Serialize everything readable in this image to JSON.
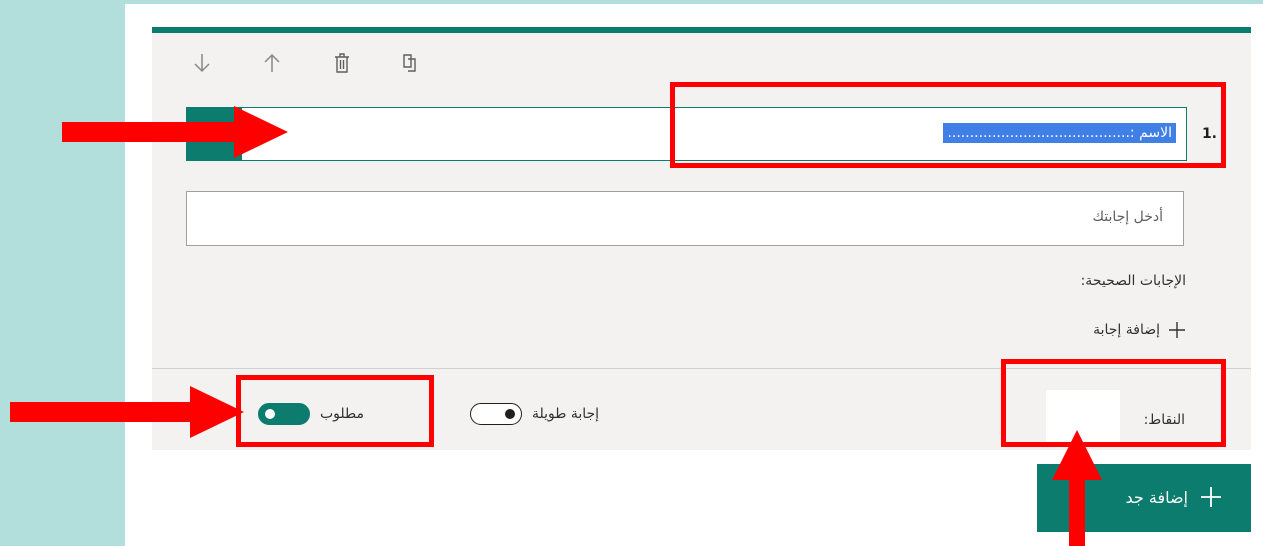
{
  "colors": {
    "accent": "#0b7c6e",
    "background_strip": "#b2dfdb",
    "card": "#f3f2f1",
    "selection": "#3f7fe6",
    "annotation": "#ff0000"
  },
  "toolbar": {
    "icons": [
      "arrow-down-icon",
      "arrow-up-icon",
      "trash-icon",
      "copy-icon"
    ]
  },
  "question": {
    "number": "1.",
    "title": "الاسم :.........................................",
    "title_selected": true
  },
  "answer": {
    "placeholder": "أدخل إجابتك"
  },
  "correct_answers": {
    "label": "الإجابات الصحيحة:",
    "add_label": "إضافة إجابة"
  },
  "footer": {
    "points_label": "النقاط:",
    "points_value": "",
    "long_answer": {
      "label": "إجابة طويلة",
      "on": false
    },
    "required": {
      "label": "مطلوب",
      "on": true
    }
  },
  "add_new": {
    "label": "إضافة جد"
  }
}
